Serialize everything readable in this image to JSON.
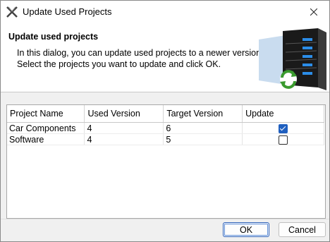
{
  "window": {
    "title": "Update Used Projects"
  },
  "header": {
    "title": "Update used projects",
    "line1": "In this dialog, you can update used projects to a newer version.",
    "line2": "Select the projects you want to update and click OK."
  },
  "table": {
    "columns": [
      "Project Name",
      "Used Version",
      "Target Version",
      "Update"
    ],
    "rows": [
      {
        "name": "Car Components",
        "used": "4",
        "target": "6",
        "update": true
      },
      {
        "name": "Software",
        "used": "4",
        "target": "5",
        "update": false
      }
    ]
  },
  "buttons": {
    "ok": "OK",
    "cancel": "Cancel"
  },
  "colors": {
    "accent": "#1f5fbf"
  }
}
